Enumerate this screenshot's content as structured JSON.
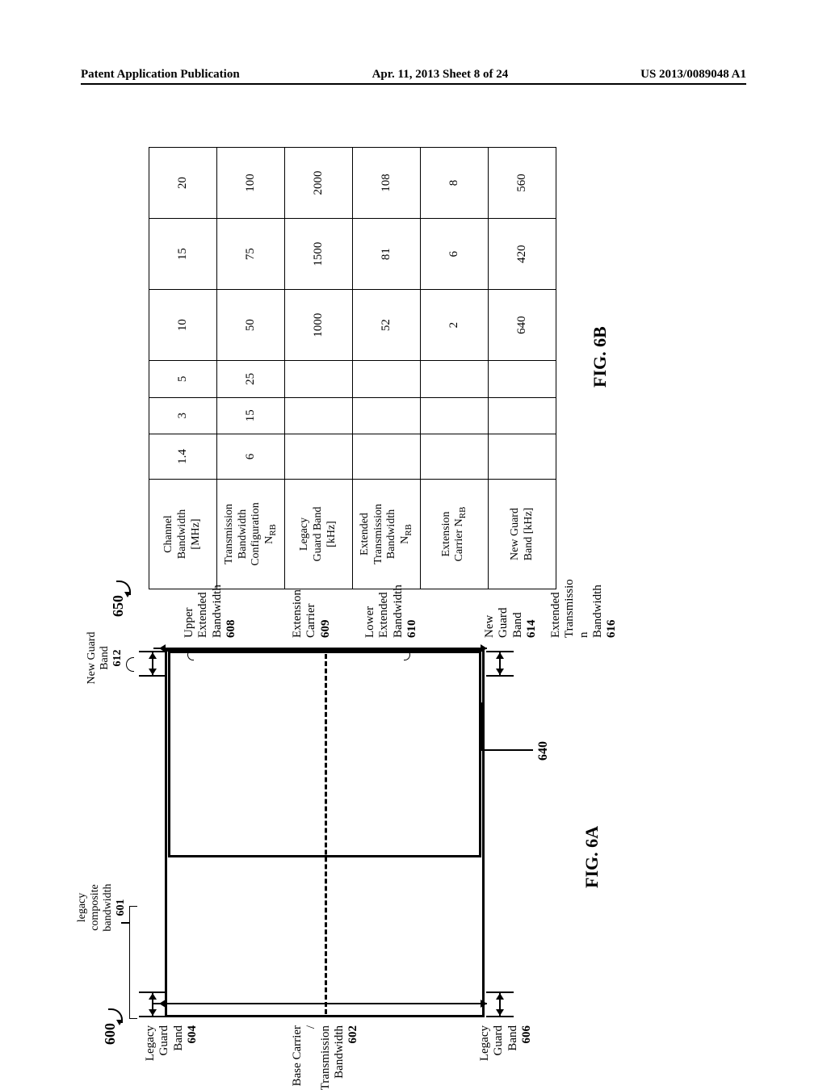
{
  "header": {
    "left": "Patent Application Publication",
    "center": "Apr. 11, 2013  Sheet 8 of 24",
    "right": "US 2013/0089048 A1"
  },
  "figA": {
    "refnum600": "600",
    "refnum650": "650",
    "cap": "FIG. 6A",
    "legacy_composite_bw": "legacy\ncomposite\nbandwidth",
    "legacy_composite_bw_num": "601",
    "new_guard_top": "New Guard\nBand",
    "new_guard_top_num": "612",
    "legacy_guard_top": "Legacy\nGuard\nBand",
    "legacy_guard_top_num": "604",
    "base_carrier": "Base Carrier /\nTransmission\nBandwidth",
    "base_carrier_num": "602",
    "legacy_guard_bot": "Legacy\nGuard\nBand",
    "legacy_guard_bot_num": "606",
    "upper_ext_bw": "Upper\nExtended\nBandwidth",
    "upper_ext_bw_num": "608",
    "extension_carrier": "Extension\nCarrier",
    "extension_carrier_num": "609",
    "lower_ext_bw": "Lower\nExtended\nBandwidth",
    "lower_ext_bw_num": "610",
    "new_guard_bot": "New Guard\nBand",
    "new_guard_bot_num": "614",
    "ext_trans_bw": "Extended\nTransmissio\nn Bandwidth",
    "ext_trans_bw_num": "616",
    "ref640": "640"
  },
  "figB": {
    "cap": "FIG. 6B",
    "rows": [
      {
        "h": "Channel\nBandwidth\n[MHz]",
        "c": [
          "1.4",
          "3",
          "5",
          "10",
          "15",
          "20"
        ]
      },
      {
        "h": "Transmission\nBandwidth\nConfiguration\nN",
        "sub": "RB",
        "c": [
          "6",
          "15",
          "25",
          "50",
          "75",
          "100"
        ]
      },
      {
        "h": "Legacy\nGuard Band\n[kHz]",
        "c": [
          "",
          "",
          "",
          "1000",
          "1500",
          "2000"
        ]
      },
      {
        "h": "Extended\nTransmission\nBandwidth\nN",
        "sub": "RB",
        "c": [
          "",
          "",
          "",
          "52",
          "81",
          "108"
        ]
      },
      {
        "h": "Extension\nCarrier N",
        "sub": "RB",
        "c": [
          "",
          "",
          "",
          "2",
          "6",
          "8"
        ]
      },
      {
        "h": "New Guard\nBand [kHz]",
        "c": [
          "",
          "",
          "",
          "640",
          "420",
          "560"
        ]
      }
    ]
  }
}
